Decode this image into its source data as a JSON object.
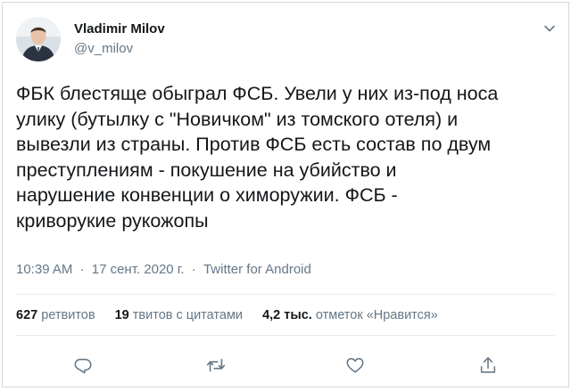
{
  "user": {
    "display_name": "Vladimir Milov",
    "handle": "@v_milov"
  },
  "tweet": {
    "text": "ФБК блестяще обыграл ФСБ. Увели у них из-под носа\nулику (бутылку с \"Новичком\" из томского отеля) и\nвывезли из страны. Против ФСБ есть состав по двум\nпреступлениям - покушение на убийство и\nнарушение конвенции о химоружии. ФСБ -\nкриворукие рукожопы",
    "time": "10:39 AM",
    "separator1": "·",
    "date": "17 сент. 2020 г.",
    "separator2": "·",
    "source": "Twitter for Android"
  },
  "stats": {
    "retweets_count": "627",
    "retweets_label": "ретвитов",
    "quotes_count": "19",
    "quotes_label": "твитов с цитатами",
    "likes_count": "4,2 тыс.",
    "likes_label": "отметок «Нравится»"
  },
  "icons": {
    "more": "chevron-down-icon",
    "reply": "reply-icon",
    "retweet": "retweet-icon",
    "like": "heart-icon",
    "share": "share-icon"
  },
  "colors": {
    "text": "#14171a",
    "secondary": "#657786",
    "border": "#e6ecf0",
    "icon": "#657786"
  }
}
